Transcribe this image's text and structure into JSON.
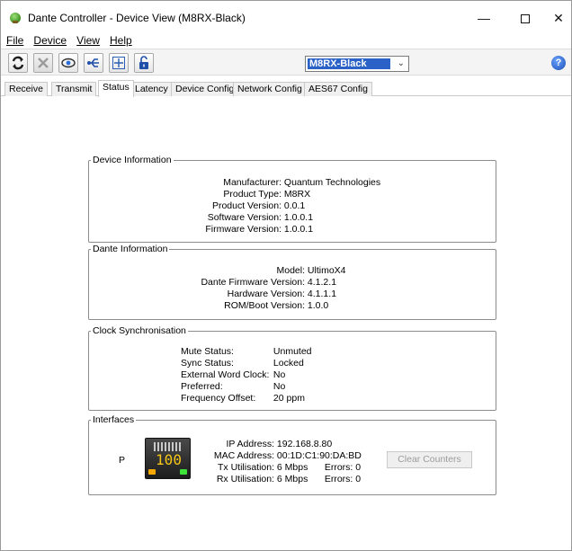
{
  "window": {
    "title": "Dante Controller - Device View (M8RX-Black)",
    "controls": {
      "minimize": "—",
      "maximize": "",
      "close": "✕"
    }
  },
  "menu": [
    "File",
    "Device",
    "View",
    "Help"
  ],
  "toolbar": {
    "buttons": [
      "refresh-icon",
      "tools-icon",
      "eye-icon",
      "network-icon",
      "add-icon",
      "lock-icon"
    ],
    "device_selector": {
      "value": "M8RX-Black"
    },
    "help_label": "?"
  },
  "tabs": [
    "Receive",
    "Transmit",
    "Status",
    "Latency",
    "Device Config",
    "Network Config",
    "AES67 Config"
  ],
  "active_tab": "Status",
  "device_information": {
    "title": "Device Information",
    "rows": [
      {
        "label": "Manufacturer:",
        "value": "Quantum Technologies"
      },
      {
        "label": "Product Type:",
        "value": "M8RX"
      },
      {
        "label": "Product Version:",
        "value": "0.0.1"
      },
      {
        "label": "Software Version:",
        "value": "1.0.0.1"
      },
      {
        "label": "Firmware Version:",
        "value": "1.0.0.1"
      }
    ]
  },
  "dante_information": {
    "title": "Dante Information",
    "rows": [
      {
        "label": "Model:",
        "value": "UltimoX4"
      },
      {
        "label": "Dante Firmware Version:",
        "value": "4.1.2.1"
      },
      {
        "label": "Hardware Version:",
        "value": "4.1.1.1"
      },
      {
        "label": "ROM/Boot Version:",
        "value": "1.0.0"
      }
    ]
  },
  "clock_synchronisation": {
    "title": "Clock Synchronisation",
    "rows": [
      {
        "label": "Mute Status:",
        "value": "Unmuted"
      },
      {
        "label": "Sync Status:",
        "value": "Locked"
      },
      {
        "label": "External Word Clock:",
        "value": "No"
      },
      {
        "label": "Preferred:",
        "value": "No"
      },
      {
        "label": "Frequency Offset:",
        "value": "20 ppm"
      }
    ]
  },
  "interfaces": {
    "title": "Interfaces",
    "port_label": "P",
    "link_speed": "100",
    "ip_label": "IP Address:",
    "ip_value": "192.168.8.80",
    "mac_label": "MAC Address:",
    "mac_value": "00:1D:C1:90:DA:BD",
    "tx_label": "Tx Utilisation:",
    "tx_value": "6 Mbps",
    "tx_errors_label": "Errors:",
    "tx_errors": "0",
    "rx_label": "Rx Utilisation:",
    "rx_value": "6 Mbps",
    "rx_errors_label": "Errors:",
    "rx_errors": "0",
    "clear_button": "Clear Counters"
  }
}
